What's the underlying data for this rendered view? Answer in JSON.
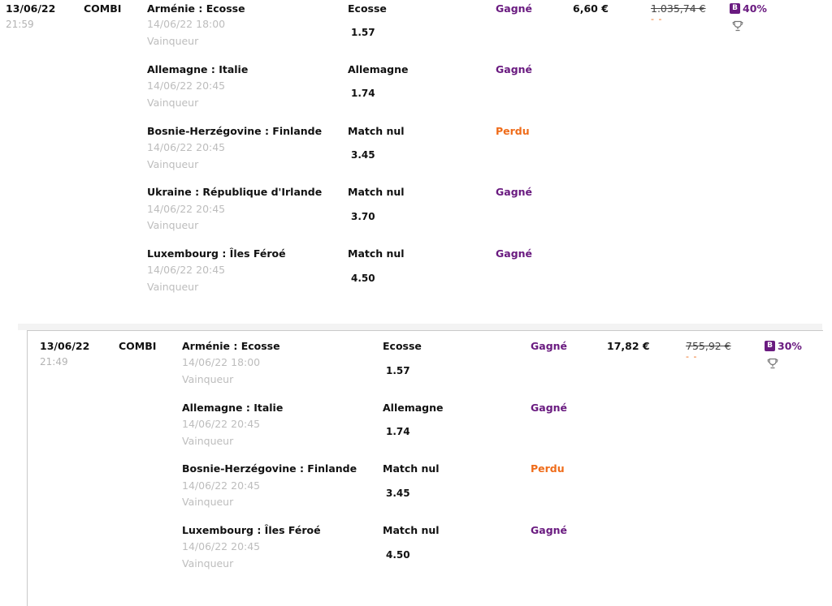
{
  "colors": {
    "won": "#6a1b80",
    "lost": "#ef6c1a",
    "muted": "#bdbdbd"
  },
  "bets": [
    {
      "date": "13/06/22",
      "time": "21:59",
      "type": "COMBI",
      "stake": "6,60 €",
      "gain": "1.035,74 €",
      "gain_dashes": "- -",
      "boost_icon": "B",
      "boost": "40%",
      "trophy_icon": "trophy-icon",
      "legs": [
        {
          "match": "Arménie : Ecosse",
          "datetime": "14/06/22 18:00",
          "market": "Vainqueur",
          "selection": "Ecosse",
          "odds": "1.57",
          "status": "Gagné"
        },
        {
          "match": "Allemagne : Italie",
          "datetime": "14/06/22 20:45",
          "market": "Vainqueur",
          "selection": "Allemagne",
          "odds": "1.74",
          "status": "Gagné"
        },
        {
          "match": "Bosnie-Herzégovine : Finlande",
          "datetime": "14/06/22 20:45",
          "market": "Vainqueur",
          "selection": "Match nul",
          "odds": "3.45",
          "status": "Perdu"
        },
        {
          "match": "Ukraine : République d'Irlande",
          "datetime": "14/06/22 20:45",
          "market": "Vainqueur",
          "selection": "Match nul",
          "odds": "3.70",
          "status": "Gagné"
        },
        {
          "match": "Luxembourg : Îles Féroé",
          "datetime": "14/06/22 20:45",
          "market": "Vainqueur",
          "selection": "Match nul",
          "odds": "4.50",
          "status": "Gagné"
        }
      ]
    },
    {
      "date": "13/06/22",
      "time": "21:49",
      "type": "COMBI",
      "stake": "17,82 €",
      "gain": "755,92 €",
      "gain_dashes": "- -",
      "boost_icon": "B",
      "boost": "30%",
      "trophy_icon": "trophy-icon",
      "legs": [
        {
          "match": "Arménie : Ecosse",
          "datetime": "14/06/22 18:00",
          "market": "Vainqueur",
          "selection": "Ecosse",
          "odds": "1.57",
          "status": "Gagné"
        },
        {
          "match": "Allemagne : Italie",
          "datetime": "14/06/22 20:45",
          "market": "Vainqueur",
          "selection": "Allemagne",
          "odds": "1.74",
          "status": "Gagné"
        },
        {
          "match": "Bosnie-Herzégovine : Finlande",
          "datetime": "14/06/22 20:45",
          "market": "Vainqueur",
          "selection": "Match nul",
          "odds": "3.45",
          "status": "Perdu"
        },
        {
          "match": "Luxembourg : Îles Féroé",
          "datetime": "14/06/22 20:45",
          "market": "Vainqueur",
          "selection": "Match nul",
          "odds": "4.50",
          "status": "Gagné"
        }
      ]
    }
  ]
}
